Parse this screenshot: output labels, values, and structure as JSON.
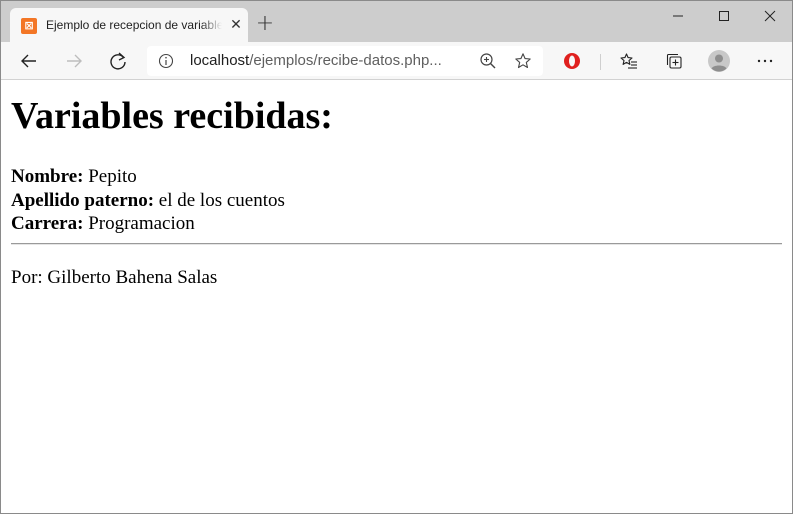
{
  "window": {
    "controls": [
      "minimize",
      "maximize",
      "close"
    ]
  },
  "tab": {
    "title": "Ejemplo de recepcion de variables",
    "favicon": "xampp-icon",
    "close_glyph": "✕"
  },
  "new_tab_glyph": "+",
  "toolbar": {
    "url_host": "localhost",
    "url_path": "/ejemplos/recibe-datos.php..."
  },
  "page": {
    "heading": "Variables recibidas:",
    "fields": [
      {
        "label": "Nombre:",
        "value": "Pepito"
      },
      {
        "label": "Apellido paterno:",
        "value": "el de los cuentos"
      },
      {
        "label": "Carrera:",
        "value": "Programacion"
      }
    ],
    "footer": "Por: Gilberto Bahena Salas"
  },
  "colors": {
    "tabstrip": "#cdcdcd",
    "toolbar": "#f7f7f7",
    "favicon": "#f37626",
    "opera_red": "#e0201e"
  }
}
